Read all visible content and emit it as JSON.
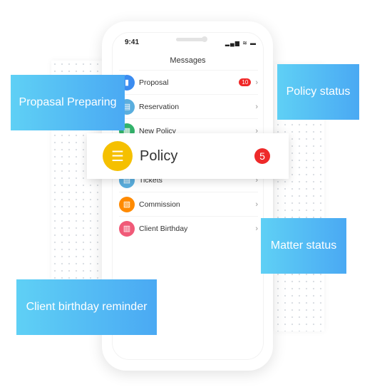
{
  "status": {
    "time": "9:41",
    "signal": "▂▄▆ ≋ ▬"
  },
  "screen": {
    "title": "Messages"
  },
  "rows": [
    {
      "label": "Proposal",
      "icon": "proposal-icon",
      "color": "#3b8cf0",
      "glyph": "▮",
      "badge": "10"
    },
    {
      "label": "Reservation",
      "icon": "clipboard-icon",
      "color": "#5aaede",
      "glyph": "▤"
    },
    {
      "label": "New Policy",
      "icon": "new-policy-icon",
      "color": "#33b36b",
      "glyph": "▦"
    },
    {
      "label": "Tickets",
      "icon": "ticket-icon",
      "color": "#5aaede",
      "glyph": "▤"
    },
    {
      "label": "Commission",
      "icon": "commission-icon",
      "color": "#ff8a00",
      "glyph": "▧"
    },
    {
      "label": "Client Birthday",
      "icon": "cake-icon",
      "color": "#f05a78",
      "glyph": "▥"
    }
  ],
  "card": {
    "label": "Policy",
    "badge": "5",
    "color": "#f5c000"
  },
  "callouts": {
    "proposal": "Propasal Preparing",
    "policy_status": "Policy status",
    "matter_status": "Matter status",
    "birthday": "Client birthday reminder"
  }
}
